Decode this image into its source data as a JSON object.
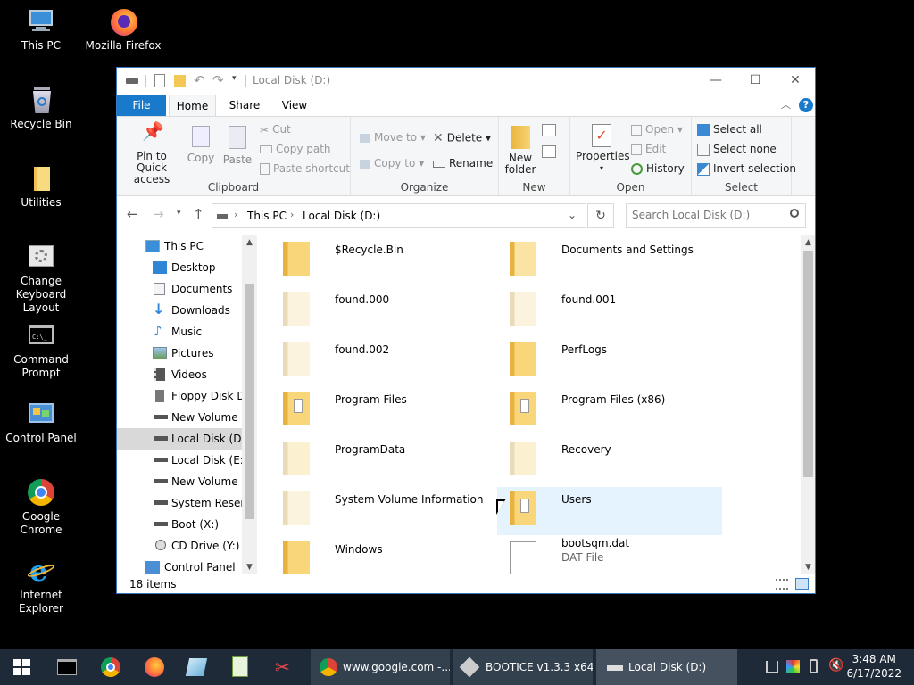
{
  "desktop": {
    "icons": [
      {
        "label": "This PC"
      },
      {
        "label": "Mozilla Firefox"
      },
      {
        "label": "Recycle Bin"
      },
      {
        "label": "Utilities"
      },
      {
        "label": "Change Keyboard Layout"
      },
      {
        "label": "Command Prompt"
      },
      {
        "label": "Control Panel"
      },
      {
        "label": "Google Chrome"
      },
      {
        "label": "Internet Explorer"
      }
    ]
  },
  "window": {
    "title": "Local Disk (D:)",
    "tabs": {
      "file": "File",
      "home": "Home",
      "share": "Share",
      "view": "View"
    },
    "ribbon": {
      "clipboard": {
        "group": "Clipboard",
        "pin": "Pin to Quick access",
        "copy": "Copy",
        "paste": "Paste",
        "cut": "Cut",
        "copy_path": "Copy path",
        "paste_shortcut": "Paste shortcut"
      },
      "organize": {
        "group": "Organize",
        "move_to": "Move to",
        "copy_to": "Copy to",
        "delete": "Delete",
        "rename": "Rename"
      },
      "new": {
        "group": "New",
        "new_folder": "New folder"
      },
      "open": {
        "group": "Open",
        "properties": "Properties",
        "open": "Open",
        "edit": "Edit",
        "history": "History"
      },
      "select": {
        "group": "Select",
        "select_all": "Select all",
        "select_none": "Select none",
        "invert": "Invert selection"
      }
    },
    "address": {
      "crumbs": [
        "This PC",
        "Local Disk (D:)"
      ]
    },
    "search": {
      "placeholder": "Search Local Disk (D:)"
    },
    "nav": {
      "items": [
        {
          "label": "This PC"
        },
        {
          "label": "Desktop"
        },
        {
          "label": "Documents"
        },
        {
          "label": "Downloads"
        },
        {
          "label": "Music"
        },
        {
          "label": "Pictures"
        },
        {
          "label": "Videos"
        },
        {
          "label": "Floppy Disk Dri"
        },
        {
          "label": "New Volume (C"
        },
        {
          "label": "Local Disk (D:)"
        },
        {
          "label": "Local Disk (E:)"
        },
        {
          "label": "New Volume (F"
        },
        {
          "label": "System Reserve"
        },
        {
          "label": "Boot (X:)"
        },
        {
          "label": "CD Drive (Y:) H"
        },
        {
          "label": "Control Panel"
        }
      ]
    },
    "files": [
      {
        "name": "$Recycle.Bin"
      },
      {
        "name": "Documents and Settings"
      },
      {
        "name": "found.000"
      },
      {
        "name": "found.001"
      },
      {
        "name": "found.002"
      },
      {
        "name": "PerfLogs"
      },
      {
        "name": "Program Files"
      },
      {
        "name": "Program Files (x86)"
      },
      {
        "name": "ProgramData"
      },
      {
        "name": "Recovery"
      },
      {
        "name": "System Volume Information"
      },
      {
        "name": "Users"
      },
      {
        "name": "Windows"
      },
      {
        "name": "bootsqm.dat",
        "type": "DAT File"
      }
    ],
    "status": {
      "count": "18 items"
    }
  },
  "taskbar": {
    "buttons": [
      {
        "label": "www.google.com -..."
      },
      {
        "label": "BOOTICE v1.3.3 x64..."
      },
      {
        "label": "Local Disk (D:)"
      }
    ],
    "time": "3:48 AM",
    "date": "6/17/2022"
  },
  "colors": {
    "accent": "#1979ca",
    "folder": "#f5c855",
    "taskbar": "#1f2a38"
  }
}
